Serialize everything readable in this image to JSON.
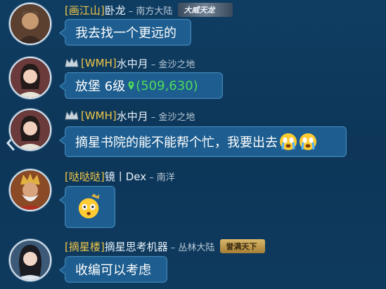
{
  "messages": [
    {
      "alliance": "[画江山]",
      "name": "卧龙",
      "region": "– 南方大陆",
      "title_badge": "大威天龙",
      "text": "我去找一个更远的"
    },
    {
      "alliance": "[WMH]",
      "name": "水中月",
      "region": "– 金沙之地",
      "text_prefix": "放堡 6级",
      "coordinates": "(509,630)"
    },
    {
      "alliance": "[WMH]",
      "name": "水中月",
      "region": "– 金沙之地",
      "text": "摘星书院的能不能帮个忙，我要出去"
    },
    {
      "alliance": "[哒哒哒]",
      "name": "镜丨Dex",
      "region": "– 南洋"
    },
    {
      "alliance": "[摘星楼]",
      "name": "摘星思考机器",
      "region": "– 丛林大陆",
      "title_badge": "誉满天下",
      "text": "收编可以考虑"
    }
  ],
  "colors": {
    "background": "#0f3b5f",
    "bubble": "#1d5d8f",
    "alliance": "#f2c746",
    "coordinates": "#4fdc5a"
  },
  "icons": [
    "crown-icon",
    "location-pin-icon",
    "crying-emoji-icon",
    "shocked-emoji-icon",
    "side-arrow-icon"
  ]
}
